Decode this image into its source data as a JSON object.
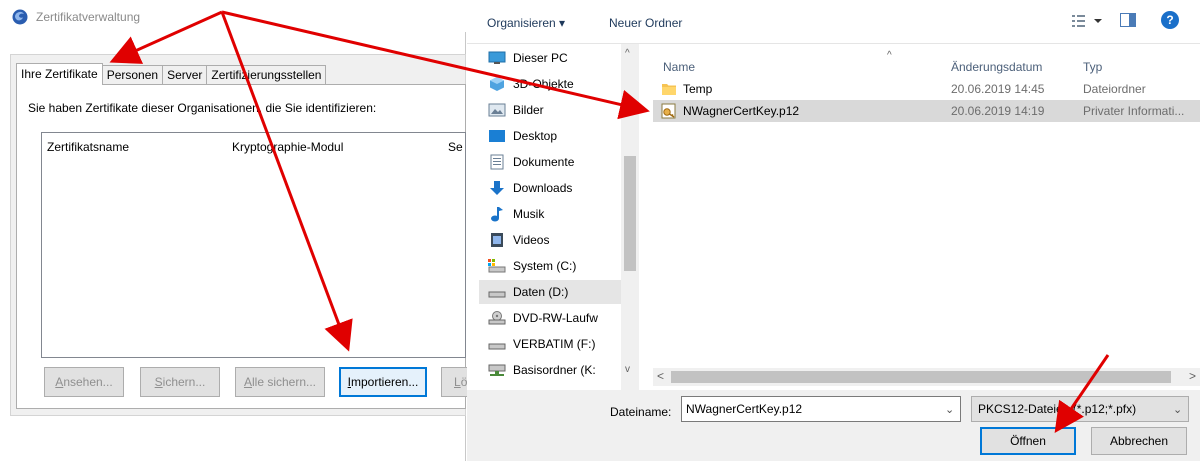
{
  "cert_manager": {
    "title": "Zertifikatverwaltung",
    "tabs": [
      {
        "label": "Ihre Zertifikate",
        "active": true
      },
      {
        "label": "Personen",
        "active": false
      },
      {
        "label": "Server",
        "active": false
      },
      {
        "label": "Zertifizierungsstellen",
        "active": false
      }
    ],
    "description": "Sie haben Zertifikate dieser Organisationen, die Sie identifizieren:",
    "columns": [
      "Zertifikatsname",
      "Kryptographie-Modul",
      "Se"
    ],
    "buttons": {
      "view": {
        "accel": "A",
        "rest": "nsehen..."
      },
      "backup": {
        "accel": "S",
        "rest": "ichern..."
      },
      "backup_all": {
        "accel": "A",
        "rest": "lle sichern..."
      },
      "import": {
        "accel": "I",
        "rest": "mportieren..."
      },
      "delete": {
        "accel": "L",
        "rest": "ö"
      }
    }
  },
  "file_dialog": {
    "toolbar": {
      "organize": "Organisieren ▾",
      "new_folder": "Neuer Ordner",
      "help": "?"
    },
    "nav_items": [
      {
        "label": "Dieser PC",
        "icon": "monitor-icon"
      },
      {
        "label": "3D-Objekte",
        "icon": "cube-icon"
      },
      {
        "label": "Bilder",
        "icon": "pictures-icon"
      },
      {
        "label": "Desktop",
        "icon": "desktop-icon"
      },
      {
        "label": "Dokumente",
        "icon": "document-icon"
      },
      {
        "label": "Downloads",
        "icon": "download-icon"
      },
      {
        "label": "Musik",
        "icon": "music-icon"
      },
      {
        "label": "Videos",
        "icon": "video-icon"
      },
      {
        "label": "System (C:)",
        "icon": "drive-c-icon"
      },
      {
        "label": "Daten (D:)",
        "icon": "drive-icon",
        "selected": true
      },
      {
        "label": "DVD-RW-Laufw",
        "icon": "dvd-icon"
      },
      {
        "label": "VERBATIM (F:)",
        "icon": "usb-drive-icon"
      },
      {
        "label": "Basisordner (K:",
        "icon": "network-drive-icon"
      }
    ],
    "columns": {
      "name": "Name",
      "date": "Änderungsdatum",
      "type": "Typ"
    },
    "files": [
      {
        "name": "Temp",
        "date": "20.06.2019 14:45",
        "type": "Dateiordner",
        "icon": "folder-icon",
        "selected": false
      },
      {
        "name": "NWagnerCertKey.p12",
        "date": "20.06.2019 14:19",
        "type": "Privater Informati...",
        "icon": "certificate-file-icon",
        "selected": true
      }
    ],
    "filename_label": "Dateiname:",
    "filename_value": "NWagnerCertKey.p12",
    "filter_value": "PKCS12-Dateien (*.p12;*.pfx)",
    "open_label": "Öffnen",
    "cancel_label": "Abbrechen"
  },
  "colors": {
    "annotation_arrow": "#e00000",
    "focus_blue": "#0078d7",
    "selection_gray": "#d9d9d9"
  }
}
